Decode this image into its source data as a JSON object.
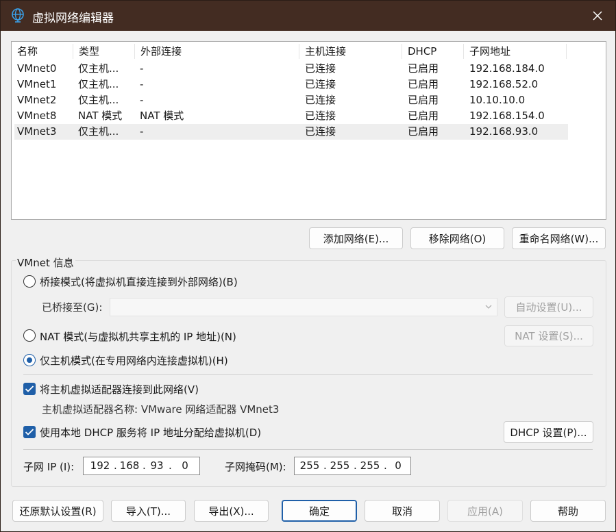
{
  "window": {
    "title": "虚拟网络编辑器",
    "icon": "globe-icon",
    "close_icon": "close-icon"
  },
  "network_list": {
    "columns": [
      "名称",
      "类型",
      "外部连接",
      "主机连接",
      "DHCP",
      "子网地址"
    ],
    "rows": [
      {
        "name": "VMnet0",
        "type": "仅主机...",
        "external": "-",
        "host": "已连接",
        "dhcp": "已启用",
        "subnet": "192.168.184.0"
      },
      {
        "name": "VMnet1",
        "type": "仅主机...",
        "external": "-",
        "host": "已连接",
        "dhcp": "已启用",
        "subnet": "192.168.52.0"
      },
      {
        "name": "VMnet2",
        "type": "仅主机...",
        "external": "-",
        "host": "已连接",
        "dhcp": "已启用",
        "subnet": "10.10.10.0"
      },
      {
        "name": "VMnet8",
        "type": "NAT 模式",
        "external": "NAT 模式",
        "host": "已连接",
        "dhcp": "已启用",
        "subnet": "192.168.154.0"
      },
      {
        "name": "VMnet3",
        "type": "仅主机...",
        "external": "-",
        "host": "已连接",
        "dhcp": "已启用",
        "subnet": "192.168.93.0"
      }
    ],
    "selected_row": "VMnet3"
  },
  "list_buttons": {
    "add": "添加网络(E)...",
    "remove": "移除网络(O)",
    "rename": "重命名网络(W)..."
  },
  "vmnet_info": {
    "group_label": "VMnet 信息",
    "bridged_mode": "桥接模式(将虚拟机直接连接到外部网络)(B)",
    "bridged_to_label": "已桥接至(G):",
    "bridged_to_value": "",
    "auto_settings": "自动设置(U)...",
    "nat_mode": "NAT 模式(与虚拟机共享主机的 IP 地址)(N)",
    "nat_settings": "NAT 设置(S)...",
    "host_only_mode": "仅主机模式(在专用网络内连接虚拟机)(H)",
    "selected_mode": "host_only",
    "connect_adapter": "将主机虚拟适配器连接到此网络(V)",
    "connect_adapter_checked": true,
    "adapter_name": "主机虚拟适配器名称: VMware 网络适配器 VMnet3",
    "use_dhcp": "使用本地 DHCP 服务将 IP 地址分配给虚拟机(D)",
    "use_dhcp_checked": true,
    "dhcp_settings": "DHCP 设置(P)...",
    "subnet_ip_label": "子网 IP (I):",
    "subnet_ip": [
      "192",
      "168",
      "93",
      "0"
    ],
    "subnet_mask_label": "子网掩码(M):",
    "subnet_mask": [
      "255",
      "255",
      "255",
      "0"
    ]
  },
  "footer_buttons": {
    "restore": "还原默认设置(R)",
    "import": "导入(T)...",
    "export": "导出(X)...",
    "ok": "确定",
    "cancel": "取消",
    "apply": "应用(A)",
    "help": "帮助"
  },
  "colors": {
    "titlebar": "#432c22",
    "accent": "#1f5fa8",
    "window_bg": "#f0f0f0"
  }
}
